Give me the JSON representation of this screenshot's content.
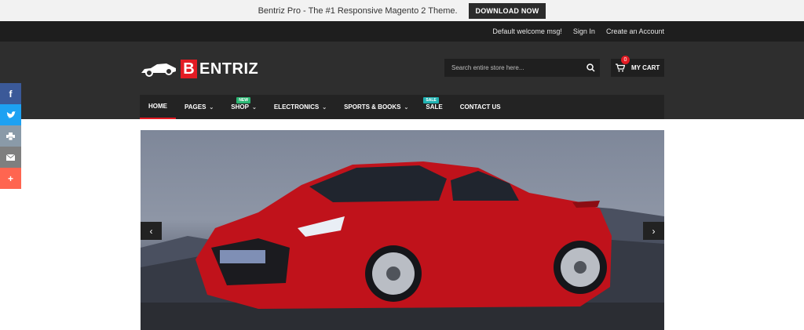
{
  "promo": {
    "text": "Bentriz Pro - The #1 Responsive Magento 2 Theme.",
    "button": "DOWNLOAD NOW"
  },
  "top_links": [
    "Default welcome msg!",
    "Sign In",
    "Create an Account"
  ],
  "logo": {
    "first": "B",
    "rest": "ENTRIZ"
  },
  "search": {
    "placeholder": "Search entire store here..."
  },
  "cart": {
    "count": "0",
    "label": "MY CART"
  },
  "nav": [
    {
      "label": "HOME",
      "active": true
    },
    {
      "label": "PAGES",
      "dropdown": true
    },
    {
      "label": "SHOP",
      "dropdown": true,
      "badge": "NEW"
    },
    {
      "label": "ELECTRONICS",
      "dropdown": true
    },
    {
      "label": "SPORTS & BOOKS",
      "dropdown": true
    },
    {
      "label": "SALE",
      "badge": "SALE"
    },
    {
      "label": "CONTACT US"
    }
  ],
  "social": [
    {
      "icon": "facebook-icon",
      "color": "#3b5998"
    },
    {
      "icon": "twitter-icon",
      "color": "#1da1f2"
    },
    {
      "icon": "print-icon",
      "color": "#8a9aa8"
    },
    {
      "icon": "email-icon",
      "color": "#7f7f7f"
    },
    {
      "icon": "plus-icon",
      "color": "#ff6550"
    }
  ],
  "colors": {
    "accent": "#e31b23",
    "header": "#2e2e2e",
    "nav": "#232323",
    "topbar": "#1e1e1e"
  }
}
